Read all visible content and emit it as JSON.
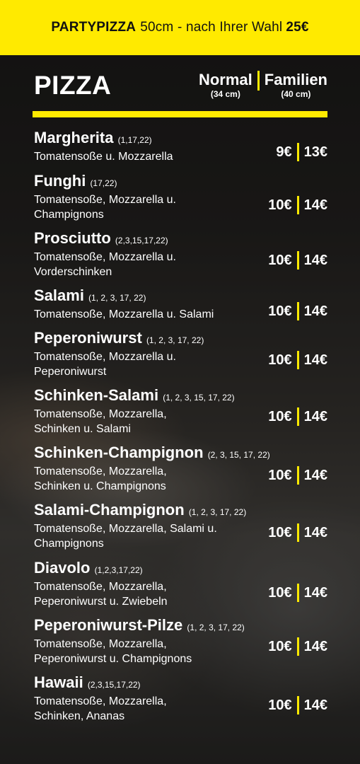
{
  "banner": {
    "bold": "PARTYPIZZA",
    "text": "50cm - nach Ihrer Wahl",
    "price": "25€"
  },
  "header": {
    "title": "PIZZA",
    "sizes": [
      {
        "name": "Normal",
        "sub": "(34 cm)"
      },
      {
        "name": "Familien",
        "sub": "(40 cm)"
      }
    ]
  },
  "colors": {
    "accent": "#ffea00",
    "text": "#ffffff"
  },
  "items": [
    {
      "name": "Margherita",
      "codes": "(1,17,22)",
      "desc": "Tomatensoße u. Mozzarella",
      "price_normal": "9€",
      "price_family": "13€"
    },
    {
      "name": "Funghi",
      "codes": "(17,22)",
      "desc": "Tomatensoße, Mozzarella u. Champignons",
      "price_normal": "10€",
      "price_family": "14€"
    },
    {
      "name": "Prosciutto",
      "codes": "(2,3,15,17,22)",
      "desc": "Tomatensoße, Mozzarella u. Vorderschinken",
      "price_normal": "10€",
      "price_family": "14€"
    },
    {
      "name": "Salami",
      "codes": "(1, 2, 3, 17, 22)",
      "desc": "Tomatensoße, Mozzarella u. Salami",
      "price_normal": "10€",
      "price_family": "14€"
    },
    {
      "name": "Peperoniwurst",
      "codes": "(1, 2, 3, 17, 22)",
      "desc": "Tomatensoße, Mozzarella u. Peperoniwurst",
      "price_normal": "10€",
      "price_family": "14€"
    },
    {
      "name": "Schinken-Salami",
      "codes": "(1, 2, 3, 15, 17, 22)",
      "desc": "Tomatensoße, Mozzarella, Schinken u. Salami",
      "price_normal": "10€",
      "price_family": "14€"
    },
    {
      "name": "Schinken-Champignon",
      "codes": "(2, 3, 15, 17, 22)",
      "desc": "Tomatensoße, Mozzarella, Schinken u. Champignons",
      "price_normal": "10€",
      "price_family": "14€"
    },
    {
      "name": "Salami-Champignon",
      "codes": "(1, 2, 3, 17, 22)",
      "desc": "Tomatensoße, Mozzarella, Salami u. Champignons",
      "price_normal": "10€",
      "price_family": "14€"
    },
    {
      "name": "Diavolo",
      "codes": "(1,2,3,17,22)",
      "desc": "Tomatensoße, Mozzarella, Peperoniwurst u. Zwiebeln",
      "price_normal": "10€",
      "price_family": "14€"
    },
    {
      "name": "Peperoniwurst-Pilze",
      "codes": "(1, 2, 3, 17, 22)",
      "desc": "Tomatensoße, Mozzarella, Peperoniwurst u. Champignons",
      "price_normal": "10€",
      "price_family": "14€"
    },
    {
      "name": "Hawaii",
      "codes": "(2,3,15,17,22)",
      "desc": "Tomatensoße, Mozzarella, Schinken, Ananas",
      "price_normal": "10€",
      "price_family": "14€"
    }
  ]
}
